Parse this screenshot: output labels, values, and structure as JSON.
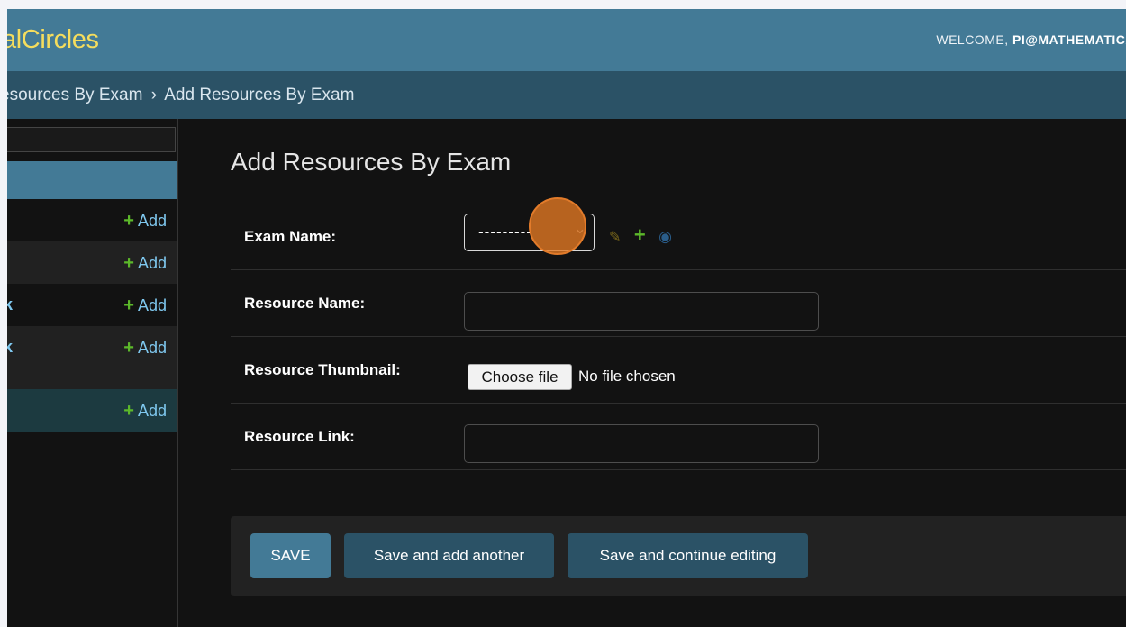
{
  "header": {
    "brand": "alCircles",
    "welcome_prefix": "WELCOME,",
    "username": "PI@MATHEMATICA"
  },
  "breadcrumbs": {
    "parent": "esources By Exam",
    "separator": "›",
    "current": "Add Resources By Exam"
  },
  "sidebar": {
    "rows": [
      {
        "name": "",
        "add_label": "Add"
      },
      {
        "name": "",
        "add_label": "Add"
      },
      {
        "name": "k",
        "add_label": "Add"
      },
      {
        "name": "k",
        "add_label": "Add"
      },
      {
        "name": "",
        "add_label": "Add"
      }
    ]
  },
  "form": {
    "title": "Add Resources By Exam",
    "exam_name": {
      "label": "Exam Name:",
      "value": "---------"
    },
    "resource_name": {
      "label": "Resource Name:",
      "value": ""
    },
    "resource_thumbnail": {
      "label": "Resource Thumbnail:",
      "button": "Choose file",
      "status": "No file chosen"
    },
    "resource_link": {
      "label": "Resource Link:",
      "value": ""
    }
  },
  "actions": {
    "save": "SAVE",
    "save_add_another": "Save and add another",
    "save_continue": "Save and continue editing"
  },
  "icons": {
    "related_edit": "pencil-icon",
    "related_add": "plus-icon",
    "related_view": "eye-icon",
    "dropdown": "chevron-down-icon"
  },
  "colors": {
    "header_bg": "#437a96",
    "breadcrumb_bg": "#2b5266",
    "brand": "#f5dd5d",
    "link": "#7fc8ef",
    "add_plus": "#5cb82a",
    "cursor_highlight": "#e67a22"
  }
}
